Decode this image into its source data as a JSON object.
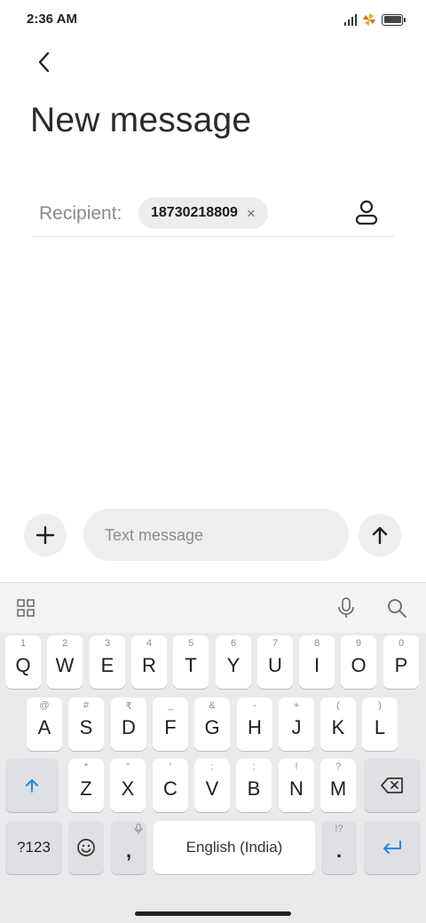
{
  "status": {
    "time": "2:36 AM"
  },
  "header": {
    "title": "New message"
  },
  "recipient": {
    "label": "Recipient:",
    "chip_number": "18730218809",
    "chip_remove": "×"
  },
  "compose": {
    "placeholder": "Text message"
  },
  "keyboard": {
    "row1": [
      {
        "hint": "1",
        "key": "Q"
      },
      {
        "hint": "2",
        "key": "W"
      },
      {
        "hint": "3",
        "key": "E"
      },
      {
        "hint": "4",
        "key": "R"
      },
      {
        "hint": "5",
        "key": "T"
      },
      {
        "hint": "6",
        "key": "Y"
      },
      {
        "hint": "7",
        "key": "U"
      },
      {
        "hint": "8",
        "key": "I"
      },
      {
        "hint": "9",
        "key": "O"
      },
      {
        "hint": "0",
        "key": "P"
      }
    ],
    "row2": [
      {
        "hint": "@",
        "key": "A"
      },
      {
        "hint": "#",
        "key": "S"
      },
      {
        "hint": "₹",
        "key": "D"
      },
      {
        "hint": "_",
        "key": "F"
      },
      {
        "hint": "&",
        "key": "G"
      },
      {
        "hint": "-",
        "key": "H"
      },
      {
        "hint": "+",
        "key": "J"
      },
      {
        "hint": "(",
        "key": "K"
      },
      {
        "hint": ")",
        "key": "L"
      }
    ],
    "row3": [
      {
        "hint": "*",
        "key": "Z"
      },
      {
        "hint": "\"",
        "key": "X"
      },
      {
        "hint": "'",
        "key": "C"
      },
      {
        "hint": ":",
        "key": "V"
      },
      {
        "hint": ";",
        "key": "B"
      },
      {
        "hint": "!",
        "key": "N"
      },
      {
        "hint": "?",
        "key": "M"
      }
    ],
    "symbols_label": "?123",
    "comma": ",",
    "space_label": "English (India)",
    "period": ".",
    "period_hint": "!?"
  },
  "colors": {
    "accent": "#1a8fe3"
  }
}
